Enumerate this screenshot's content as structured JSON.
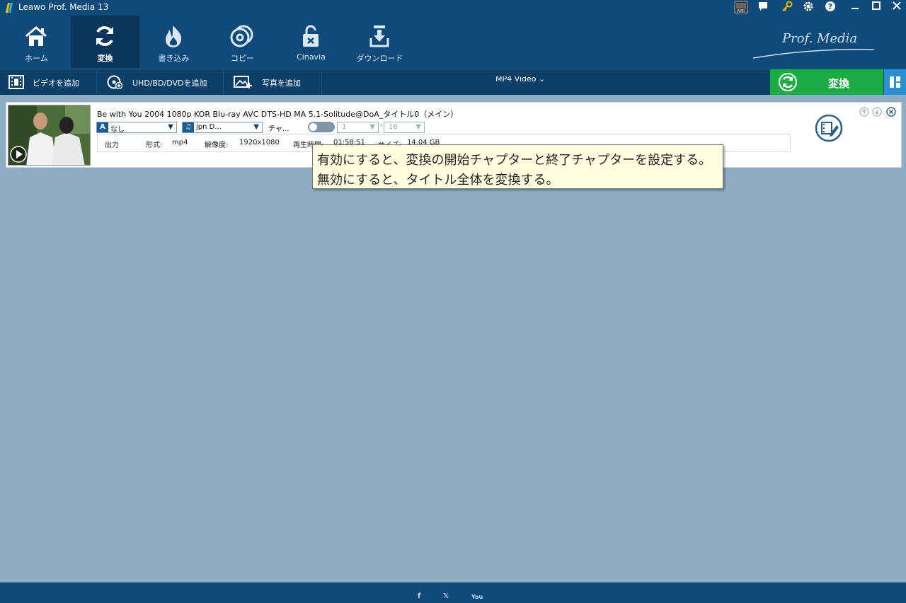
{
  "window": {
    "title": "Leawo Prof. Media 13"
  },
  "titlebar_icons": {
    "amd": "amd-icon",
    "feedback": "chat-icon",
    "register": "key-icon",
    "settings": "gear-icon",
    "help": "help-icon",
    "minimize": "minimize-icon",
    "maximize": "maximize-icon",
    "close": "close-icon"
  },
  "nav": {
    "items": [
      {
        "label": "ホーム",
        "icon": "home-icon"
      },
      {
        "label": "変換",
        "icon": "convert-icon",
        "active": true
      },
      {
        "label": "書き込み",
        "icon": "burn-icon"
      },
      {
        "label": "コピー",
        "icon": "copy-disc-icon"
      },
      {
        "label": "Cinavia",
        "icon": "unlock-icon"
      },
      {
        "label": "ダウンロード",
        "icon": "download-icon"
      }
    ],
    "brand": "Prof. Media"
  },
  "toolbar": {
    "add_video": "ビデオを追加",
    "add_disc": "UHD/BD/DVDを追加",
    "add_photo": "写真を追加",
    "format": "MP4 Video",
    "convert": "変換"
  },
  "item": {
    "title": "Be with You 2004 1080p KOR Blu-ray AVC DTS-HD MA 5.1-Solitude@DoA_タイトル0（メイン）",
    "subtitle_badge": "A",
    "subtitle_value": "なし",
    "audio_value": "jpn D...",
    "chapter_label": "チャ...",
    "chapter_start": "1",
    "chapter_end": "16",
    "range_sep": "-",
    "output_label": "出力",
    "format_label": "形式:",
    "format_value": "mp4",
    "resolution_label": "解像度:",
    "resolution_value": "1920x1080",
    "duration_label": "再生時間:",
    "duration_value": "01:58:51",
    "size_label": "サイズ:",
    "size_value": "14.04 GB"
  },
  "tooltip": {
    "line1": "有効にすると、変換の開始チャプターと終了チャプターを設定する。",
    "line2": "無効にすると、タイトル全体を変換する。"
  },
  "colors": {
    "titlebar_bg": "#0f4a7b",
    "toolbar_bg": "#0d3f69",
    "workspace_bg": "#8faec5",
    "convert_green": "#1aad46",
    "accent_blue": "#2b8fd3",
    "tooltip_bg": "#ffffe1"
  },
  "footer": {
    "facebook": "f",
    "x": "𝕏",
    "youtube": "You"
  }
}
